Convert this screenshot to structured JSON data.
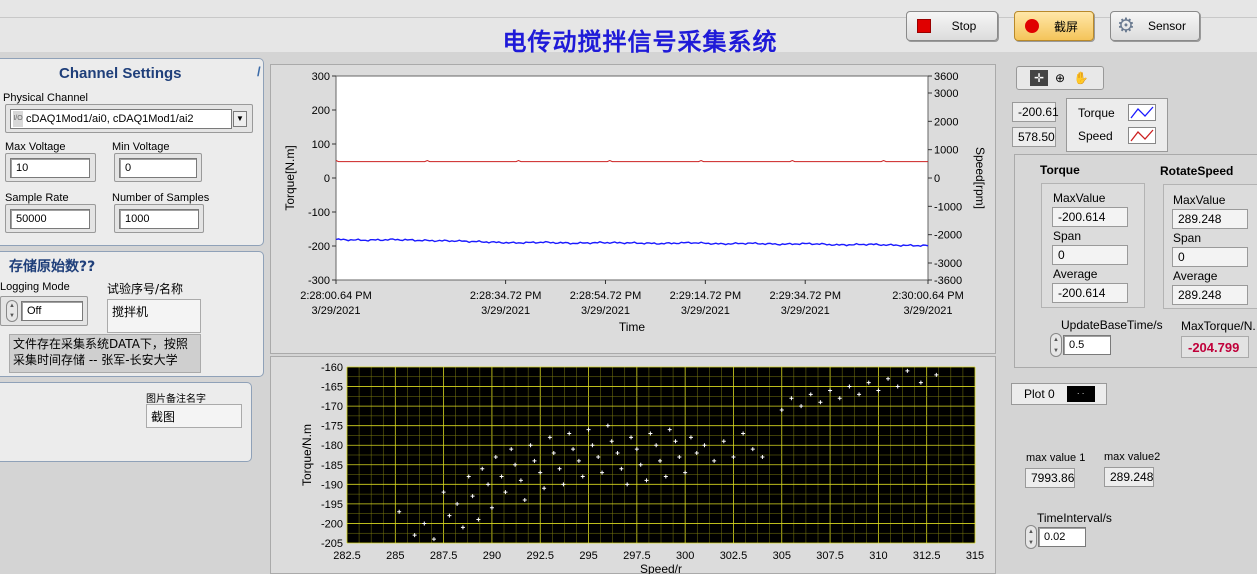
{
  "header": {
    "title": "电传动搅拌信号采集系统",
    "stop_label": "Stop",
    "screenshot_label": "截屏",
    "sensor_label": "Sensor"
  },
  "channel_settings": {
    "title": "Channel Settings",
    "physical_channel_label": "Physical Channel",
    "physical_channel_value": "cDAQ1Mod1/ai0, cDAQ1Mod1/ai2",
    "max_voltage_label": "Max Voltage",
    "max_voltage_value": "10",
    "min_voltage_label": "Min Voltage",
    "min_voltage_value": "0",
    "sample_rate_label": "Sample Rate",
    "sample_rate_value": "50000",
    "num_samples_label": "Number of Samples",
    "num_samples_value": "1000"
  },
  "storage": {
    "title": "存储原始数??",
    "logging_mode_label": "Logging Mode",
    "logging_mode_value": "Off",
    "test_name_label": "试验序号/名称",
    "test_name_value": "搅拌机",
    "note_line1": "文件存在采集系统DATA下，按照",
    "note_line2": "采集时间存储 -- 张军-长安大学"
  },
  "picture_note": {
    "label": "图片备注名字",
    "value": "截图"
  },
  "time_chart": {
    "graph_tools": [
      "crosshair-icon",
      "zoom-icon",
      "pan-hand-icon"
    ],
    "cursor_value_1": "-200.61",
    "cursor_value_2": "578.50",
    "legend": [
      "Torque",
      "Speed"
    ],
    "series_colors": {
      "Torque": "#1a1aff",
      "Speed": "#cc2020"
    },
    "xlabel": "Time",
    "ylabel_left": "Torque[N.m]",
    "ylabel_right": "Speed[rpm]",
    "left_ticks": [
      "300",
      "200",
      "100",
      "0",
      "-100",
      "-200",
      "-300"
    ],
    "right_ticks": [
      "3600",
      "3000",
      "2000",
      "1000",
      "0",
      "-1000",
      "-2000",
      "-3000",
      "-3600"
    ],
    "x_ticks": [
      {
        "time": "2:28:00.64 PM",
        "date": "3/29/2021"
      },
      {
        "time": "2:28:34.72 PM",
        "date": "3/29/2021"
      },
      {
        "time": "2:28:54.72 PM",
        "date": "3/29/2021"
      },
      {
        "time": "2:29:14.72 PM",
        "date": "3/29/2021"
      },
      {
        "time": "2:29:34.72 PM",
        "date": "3/29/2021"
      },
      {
        "time": "2:30:00.64 PM",
        "date": "3/29/2021"
      }
    ]
  },
  "stats": {
    "torque_title": "Torque",
    "speed_title": "RotateSpeed",
    "max_label": "MaxValue",
    "span_label": "Span",
    "avg_label": "Average",
    "torque_max": "-200.614",
    "torque_span": "0",
    "torque_avg": "-200.614",
    "speed_max": "289.248",
    "speed_span": "0",
    "speed_avg": "289.248",
    "update_label": "UpdateBaseTime/s",
    "update_value": "0.5",
    "max_torque_label": "MaxTorque/N.",
    "max_torque_value": "-204.799"
  },
  "scatter_side": {
    "plot_label": "Plot 0",
    "max1_label": "max value 1",
    "max1_value": "7993.86",
    "max2_label": "max value2",
    "max2_value": "289.248",
    "interval_label": "TimeInterval/s",
    "interval_value": "0.02"
  },
  "chart_data": [
    {
      "type": "line",
      "xlabel": "Time",
      "ylabel": "Torque[N.m]",
      "ylabel_right": "Speed[rpm]",
      "ylim": [
        -300,
        300
      ],
      "ylim_right": [
        -3600,
        3600
      ],
      "x_range": [
        "2:28:00.64 PM",
        "2:30:00.64 PM"
      ],
      "series": [
        {
          "name": "Torque",
          "axis": "left",
          "approx_values": [
            -181,
            -183,
            -181,
            -184,
            -185,
            -188,
            -191,
            -189,
            -192,
            -190,
            -191,
            -193,
            -190,
            -194,
            -192,
            -195,
            -193,
            -197,
            -195,
            -198,
            -199
          ]
        },
        {
          "name": "Speed",
          "axis": "right",
          "approx_values": [
            578,
            578,
            578,
            578,
            578,
            578,
            578,
            578,
            578,
            578,
            578
          ]
        }
      ],
      "grid": false
    },
    {
      "type": "scatter",
      "xlabel": "Speed/r",
      "ylabel": "Torque/N.m",
      "xlim": [
        282.5,
        315
      ],
      "ylim": [
        -205,
        -160
      ],
      "x_ticks": [
        "282.5",
        "285",
        "287.5",
        "290",
        "292.5",
        "295",
        "297.5",
        "300",
        "302.5",
        "305",
        "307.5",
        "310",
        "312.5",
        "315"
      ],
      "y_ticks": [
        "-160",
        "-165",
        "-170",
        "-175",
        "-180",
        "-185",
        "-190",
        "-195",
        "-200",
        "-205"
      ],
      "grid": true,
      "series": [
        {
          "name": "Plot 0",
          "points": [
            [
              285.2,
              -197
            ],
            [
              286.0,
              -203
            ],
            [
              286.5,
              -200
            ],
            [
              287.0,
              -204
            ],
            [
              287.5,
              -192
            ],
            [
              287.8,
              -198
            ],
            [
              288.2,
              -195
            ],
            [
              288.5,
              -201
            ],
            [
              288.8,
              -188
            ],
            [
              289.0,
              -193
            ],
            [
              289.3,
              -199
            ],
            [
              289.5,
              -186
            ],
            [
              289.8,
              -190
            ],
            [
              290.0,
              -196
            ],
            [
              290.2,
              -183
            ],
            [
              290.5,
              -188
            ],
            [
              290.7,
              -192
            ],
            [
              291.0,
              -181
            ],
            [
              291.2,
              -185
            ],
            [
              291.5,
              -189
            ],
            [
              291.7,
              -194
            ],
            [
              292.0,
              -180
            ],
            [
              292.2,
              -184
            ],
            [
              292.5,
              -187
            ],
            [
              292.7,
              -191
            ],
            [
              293.0,
              -178
            ],
            [
              293.2,
              -182
            ],
            [
              293.5,
              -186
            ],
            [
              293.7,
              -190
            ],
            [
              294.0,
              -177
            ],
            [
              294.2,
              -181
            ],
            [
              294.5,
              -184
            ],
            [
              294.7,
              -188
            ],
            [
              295.0,
              -176
            ],
            [
              295.2,
              -180
            ],
            [
              295.5,
              -183
            ],
            [
              295.7,
              -187
            ],
            [
              296.0,
              -175
            ],
            [
              296.2,
              -179
            ],
            [
              296.5,
              -182
            ],
            [
              296.7,
              -186
            ],
            [
              297.0,
              -190
            ],
            [
              297.2,
              -178
            ],
            [
              297.5,
              -181
            ],
            [
              297.7,
              -185
            ],
            [
              298.0,
              -189
            ],
            [
              298.2,
              -177
            ],
            [
              298.5,
              -180
            ],
            [
              298.7,
              -184
            ],
            [
              299.0,
              -188
            ],
            [
              299.2,
              -176
            ],
            [
              299.5,
              -179
            ],
            [
              299.7,
              -183
            ],
            [
              300.0,
              -187
            ],
            [
              300.3,
              -178
            ],
            [
              300.6,
              -182
            ],
            [
              301.0,
              -180
            ],
            [
              301.5,
              -184
            ],
            [
              302.0,
              -179
            ],
            [
              302.5,
              -183
            ],
            [
              303.0,
              -177
            ],
            [
              303.5,
              -181
            ],
            [
              304.0,
              -183
            ],
            [
              305.0,
              -171
            ],
            [
              305.5,
              -168
            ],
            [
              306.0,
              -170
            ],
            [
              306.5,
              -167
            ],
            [
              307.0,
              -169
            ],
            [
              307.5,
              -166
            ],
            [
              308.0,
              -168
            ],
            [
              308.5,
              -165
            ],
            [
              309.0,
              -167
            ],
            [
              309.5,
              -164
            ],
            [
              310.0,
              -166
            ],
            [
              310.5,
              -163
            ],
            [
              311.0,
              -165
            ],
            [
              311.5,
              -161
            ],
            [
              312.2,
              -164
            ],
            [
              313.0,
              -162
            ]
          ]
        }
      ]
    }
  ]
}
